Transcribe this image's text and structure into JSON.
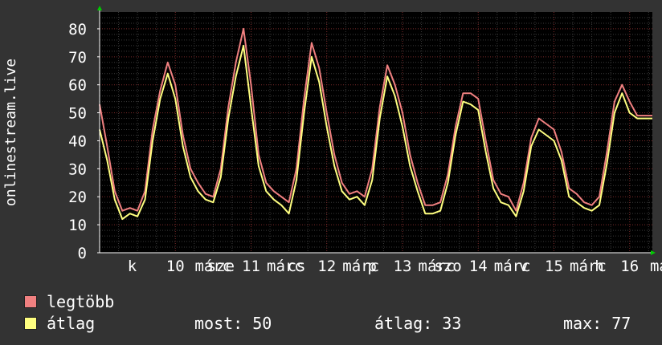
{
  "chart_data": {
    "type": "line",
    "ylabel": "onlinestream.live",
    "ylim": [
      0,
      86
    ],
    "y_ticks": [
      0,
      10,
      20,
      30,
      40,
      50,
      60,
      70,
      80
    ],
    "x_tick_labels": [
      {
        "t": 0.43,
        "label": "k"
      },
      {
        "t": 1.0,
        "label": "10"
      },
      {
        "t": 1.5,
        "label": "márc"
      },
      {
        "t": 1.6,
        "label": "sze"
      },
      {
        "t": 2.0,
        "label": "11"
      },
      {
        "t": 2.45,
        "label": "márc"
      },
      {
        "t": 2.6,
        "label": "cs"
      },
      {
        "t": 3.0,
        "label": "12"
      },
      {
        "t": 3.45,
        "label": "márc"
      },
      {
        "t": 3.6,
        "label": "p"
      },
      {
        "t": 4.0,
        "label": "13"
      },
      {
        "t": 4.45,
        "label": "márc"
      },
      {
        "t": 4.6,
        "label": "szo"
      },
      {
        "t": 5.0,
        "label": "14"
      },
      {
        "t": 5.45,
        "label": "márc"
      },
      {
        "t": 5.6,
        "label": "v"
      },
      {
        "t": 6.0,
        "label": "15"
      },
      {
        "t": 6.45,
        "label": "márc"
      },
      {
        "t": 6.6,
        "label": "h"
      },
      {
        "t": 7.0,
        "label": "16"
      },
      {
        "t": 7.45,
        "label": "már"
      }
    ],
    "grid": true,
    "series": [
      {
        "name": "legtöbb",
        "color": "#f08080",
        "x": [
          0,
          0.1,
          0.2,
          0.3,
          0.4,
          0.5,
          0.6,
          0.7,
          0.8,
          0.9,
          1.0,
          1.1,
          1.2,
          1.3,
          1.4,
          1.5,
          1.6,
          1.7,
          1.8,
          1.9,
          2.0,
          2.1,
          2.2,
          2.3,
          2.4,
          2.5,
          2.6,
          2.7,
          2.8,
          2.9,
          3.0,
          3.1,
          3.2,
          3.3,
          3.4,
          3.5,
          3.6,
          3.7,
          3.8,
          3.9,
          4.0,
          4.1,
          4.2,
          4.3,
          4.4,
          4.5,
          4.6,
          4.7,
          4.8,
          4.9,
          5.0,
          5.1,
          5.2,
          5.3,
          5.4,
          5.5,
          5.6,
          5.7,
          5.8,
          5.9,
          6.0,
          6.1,
          6.2,
          6.3,
          6.4,
          6.5,
          6.6,
          6.7,
          6.8,
          6.9,
          7.0,
          7.1,
          7.2,
          7.3
        ],
        "values": [
          53,
          38,
          22,
          15,
          16,
          15,
          22,
          44,
          58,
          68,
          60,
          42,
          30,
          25,
          21,
          20,
          30,
          52,
          68,
          80,
          60,
          35,
          25,
          22,
          20,
          18,
          30,
          55,
          75,
          66,
          50,
          35,
          25,
          21,
          22,
          20,
          30,
          52,
          67,
          60,
          50,
          35,
          25,
          17,
          17,
          18,
          28,
          45,
          57,
          57,
          55,
          40,
          26,
          21,
          20,
          15,
          25,
          41,
          48,
          46,
          44,
          36,
          23,
          21,
          18,
          17,
          20,
          36,
          54,
          60,
          54,
          49,
          49,
          49
        ]
      },
      {
        "name": "átlag",
        "color": "#ffff80",
        "x": [
          0,
          0.1,
          0.2,
          0.3,
          0.4,
          0.5,
          0.6,
          0.7,
          0.8,
          0.9,
          1.0,
          1.1,
          1.2,
          1.3,
          1.4,
          1.5,
          1.6,
          1.7,
          1.8,
          1.9,
          2.0,
          2.1,
          2.2,
          2.3,
          2.4,
          2.5,
          2.6,
          2.7,
          2.8,
          2.9,
          3.0,
          3.1,
          3.2,
          3.3,
          3.4,
          3.5,
          3.6,
          3.7,
          3.8,
          3.9,
          4.0,
          4.1,
          4.2,
          4.3,
          4.4,
          4.5,
          4.6,
          4.7,
          4.8,
          4.9,
          5.0,
          5.1,
          5.2,
          5.3,
          5.4,
          5.5,
          5.6,
          5.7,
          5.8,
          5.9,
          6.0,
          6.1,
          6.2,
          6.3,
          6.4,
          6.5,
          6.6,
          6.7,
          6.8,
          6.9,
          7.0,
          7.1,
          7.2,
          7.3
        ],
        "values": [
          44,
          33,
          19,
          12,
          14,
          13,
          19,
          40,
          55,
          64,
          55,
          38,
          27,
          22,
          19,
          18,
          27,
          48,
          63,
          74,
          52,
          31,
          22,
          19,
          17,
          14,
          26,
          50,
          70,
          61,
          45,
          31,
          22,
          19,
          20,
          17,
          26,
          48,
          63,
          56,
          45,
          31,
          22,
          14,
          14,
          15,
          25,
          42,
          54,
          53,
          51,
          36,
          23,
          18,
          17,
          13,
          22,
          38,
          44,
          42,
          40,
          33,
          20,
          18,
          16,
          15,
          17,
          32,
          50,
          57,
          50,
          48,
          48,
          48
        ]
      }
    ]
  },
  "legend": {
    "max_label": "legtöbb",
    "avg_label": "átlag",
    "max_color": "#f08080",
    "avg_color": "#ffff80"
  },
  "stats": {
    "now": "most: 50",
    "avg": "átlag: 33",
    "max": "max: 77"
  }
}
